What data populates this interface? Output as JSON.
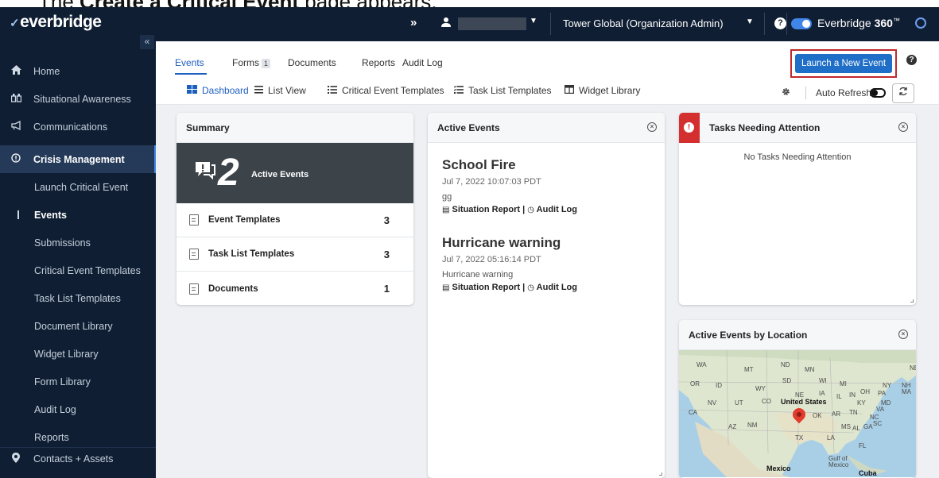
{
  "caption": {
    "prefix": "The ",
    "bold": "Create a Critical Event",
    "suffix": " page appears."
  },
  "sidebar": {
    "logo": "everbridge",
    "collapse": "«",
    "items": [
      {
        "label": "Home",
        "icon": "home-icon"
      },
      {
        "label": "Situational Awareness",
        "icon": "binoculars-icon"
      },
      {
        "label": "Communications",
        "icon": "megaphone-icon"
      },
      {
        "label": "Crisis Management",
        "icon": "alert-circle-icon"
      },
      {
        "label": "Launch Critical Event"
      },
      {
        "label": "Events"
      },
      {
        "label": "Submissions"
      },
      {
        "label": "Critical Event Templates"
      },
      {
        "label": "Task List Templates"
      },
      {
        "label": "Document Library"
      },
      {
        "label": "Widget Library"
      },
      {
        "label": "Form Library"
      },
      {
        "label": "Audit Log"
      },
      {
        "label": "Reports"
      },
      {
        "label": "Contacts + Assets",
        "icon": "location-pin-icon"
      }
    ]
  },
  "topbar": {
    "expand": "»",
    "org": "Tower Global (Organization Admin)",
    "brand": "Everbridge ",
    "brand_bold": "360",
    "brand_tm": "™"
  },
  "tabs": [
    {
      "label": "Events",
      "active": true
    },
    {
      "label": "Forms",
      "badge": "1"
    },
    {
      "label": "Documents"
    },
    {
      "label": "Reports"
    },
    {
      "label": "Audit Log"
    }
  ],
  "subtabs": [
    {
      "label": "Dashboard",
      "icon": "dashboard-icon",
      "active": true
    },
    {
      "label": "List View",
      "icon": "list-icon"
    },
    {
      "label": "Critical Event Templates",
      "icon": "list-bullets-icon"
    },
    {
      "label": "Task List Templates",
      "icon": "task-list-icon"
    },
    {
      "label": "Widget Library",
      "icon": "widget-icon"
    }
  ],
  "launch_button": "Launch a New Event",
  "auto_refresh": "Auto Refresh",
  "summary": {
    "title": "Summary",
    "active_count": "2",
    "active_label": "Active Events",
    "rows": [
      {
        "label": "Event Templates",
        "count": "3"
      },
      {
        "label": "Task List Templates",
        "count": "3"
      },
      {
        "label": "Documents",
        "count": "1"
      }
    ]
  },
  "active_events": {
    "title": "Active Events",
    "events": [
      {
        "title": "School Fire",
        "date": "Jul 7, 2022 10:07:03 PDT",
        "desc": "gg",
        "links": "Situation Report | ",
        "audit": "Audit Log"
      },
      {
        "title": "Hurricane warning",
        "date": "Jul 7, 2022 05:16:14 PDT",
        "desc": "Hurricane warning",
        "links": "Situation Report | ",
        "audit": "Audit Log"
      }
    ]
  },
  "tasks": {
    "title": "Tasks Needing Attention",
    "empty": "No Tasks Needing Attention"
  },
  "location": {
    "title": "Active Events by Location",
    "labels": {
      "us": "United States",
      "mexico": "Mexico",
      "gulf": "Gulf of",
      "gulf2": "Mexico",
      "cuba": "Cuba",
      "wa": "WA",
      "mt": "MT",
      "nd": "ND",
      "mn": "MN",
      "or": "OR",
      "id": "ID",
      "wy": "WY",
      "sd": "SD",
      "wi": "WI",
      "mi": "MI",
      "ny": "NY",
      "nb": "NB",
      "ne": "NE",
      "ia": "IA",
      "nv": "NV",
      "ut": "UT",
      "ca": "CA",
      "co": "CO",
      "az": "AZ",
      "nm": "NM",
      "tx": "TX",
      "la": "LA",
      "ms": "MS",
      "al": "AL",
      "ga": "GA",
      "fl": "FL",
      "ok": "OK",
      "ar": "AR",
      "tn": "TN",
      "ky": "KY",
      "va": "VA",
      "nc": "NC",
      "sc": "SC",
      "pa": "PA",
      "oh": "OH",
      "in": "IN",
      "il": "IL",
      "md": "MD",
      "nh": "NH",
      "ma": "MA"
    }
  }
}
